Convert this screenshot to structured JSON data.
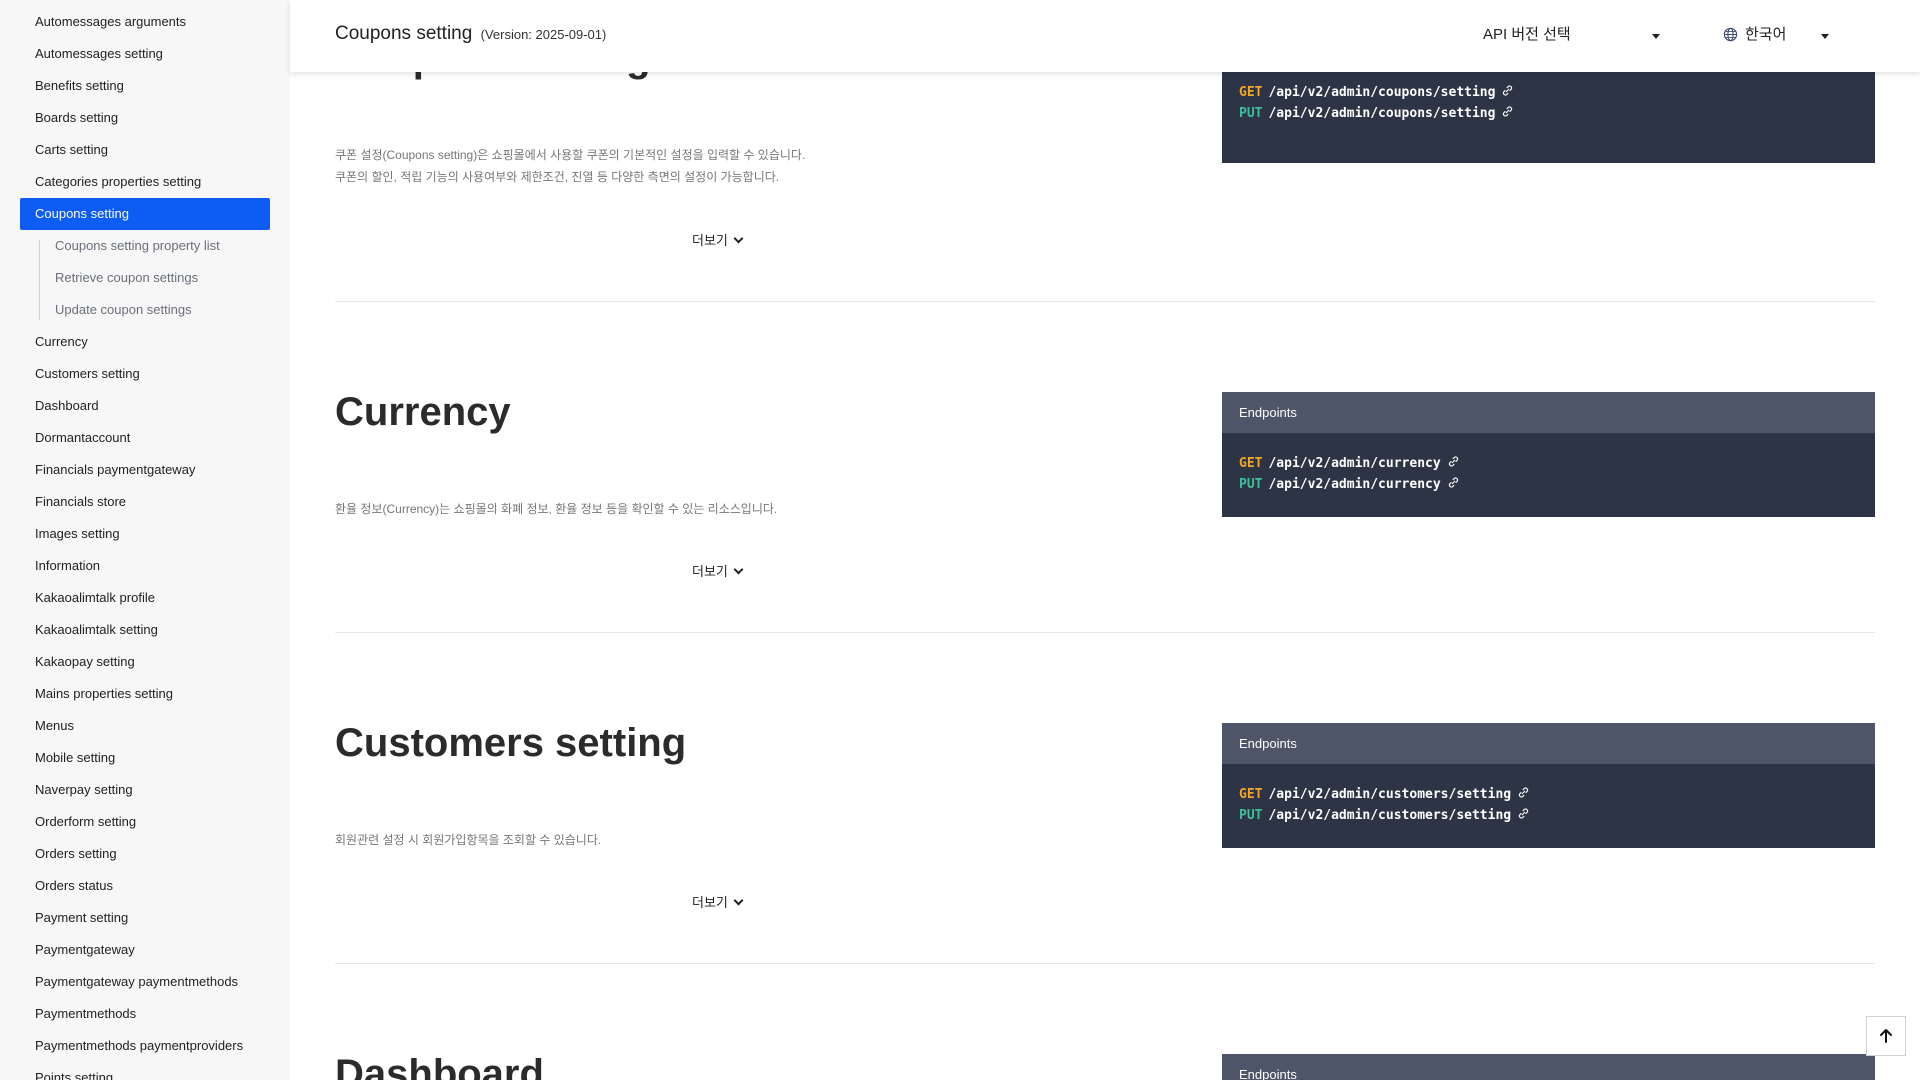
{
  "sidebar": {
    "items": [
      "Automessages arguments",
      "Automessages setting",
      "Benefits setting",
      "Boards setting",
      "Carts setting",
      "Categories properties setting",
      "Coupons setting",
      "Currency",
      "Customers setting",
      "Dashboard",
      "Dormantaccount",
      "Financials paymentgateway",
      "Financials store",
      "Images setting",
      "Information",
      "Kakaoalimtalk profile",
      "Kakaoalimtalk setting",
      "Kakaopay setting",
      "Mains properties setting",
      "Menus",
      "Mobile setting",
      "Naverpay setting",
      "Orderform setting",
      "Orders setting",
      "Orders status",
      "Payment setting",
      "Paymentgateway",
      "Paymentgateway paymentmethods",
      "Paymentmethods",
      "Paymentmethods paymentproviders",
      "Points setting"
    ],
    "active_item": "Coupons setting",
    "sub_items": [
      "Coupons setting property list",
      "Retrieve coupon settings",
      "Update coupon settings"
    ]
  },
  "header": {
    "title": "Coupons setting",
    "version": "(Version: 2025-09-01)",
    "api_version_select": "API 버전 선택",
    "language_select": "한국어"
  },
  "sections": {
    "coupons": {
      "title": "Coupons setting",
      "desc_line1": "쿠폰 설정(Coupons setting)은 쇼핑몰에서 사용할 쿠폰의 기본적인 설정을 입력할 수 있습니다.",
      "desc_line2": "쿠폰의 할인, 적립 기능의 사용여부와 제한조건, 진열 등 다양한 측면의 설정이 가능합니다.",
      "more": "더보기",
      "endpoints": [
        {
          "method": "GET",
          "path": "/api/v2/admin/coupons/setting"
        },
        {
          "method": "PUT",
          "path": "/api/v2/admin/coupons/setting"
        }
      ]
    },
    "currency": {
      "title": "Currency",
      "desc_line1": "환율 정보(Currency)는 쇼핑몰의 화폐 정보, 환율 정보 등을 확인할 수 있는 리소스입니다.",
      "more": "더보기",
      "endpoints_label": "Endpoints",
      "endpoints": [
        {
          "method": "GET",
          "path": "/api/v2/admin/currency"
        },
        {
          "method": "PUT",
          "path": "/api/v2/admin/currency"
        }
      ]
    },
    "customers": {
      "title": "Customers setting",
      "desc_line1": "회원관련 설정 시 회원가입항목을 조회할 수 있습니다.",
      "more": "더보기",
      "endpoints_label": "Endpoints",
      "endpoints": [
        {
          "method": "GET",
          "path": "/api/v2/admin/customers/setting"
        },
        {
          "method": "PUT",
          "path": "/api/v2/admin/customers/setting"
        }
      ]
    },
    "dashboard": {
      "title": "Dashboard",
      "endpoints_label": "Endpoints"
    }
  },
  "colors": {
    "active_nav": "#0d5cf4",
    "endpoint_bg": "#2d3446",
    "endpoint_head": "#4e5569",
    "get_method": "#f5a623",
    "put_method": "#3dbf9a"
  },
  "icons": {
    "globe": "globe-icon",
    "link": "link-icon",
    "chevron": "chevron-down-icon",
    "top": "arrow-up-icon"
  }
}
